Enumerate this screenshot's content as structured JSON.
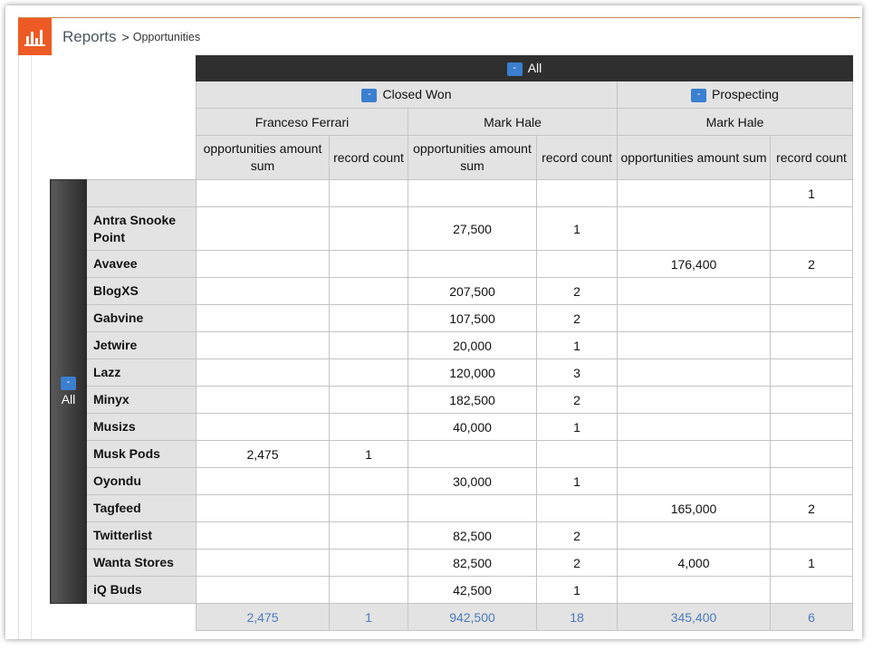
{
  "breadcrumb": {
    "root": "Reports",
    "separator": ">",
    "current": "Opportunities"
  },
  "icons": {
    "brand": "bar-chart-icon",
    "toggle": "collapse-toggle"
  },
  "colors": {
    "brand": "#ee5a24",
    "totals_text": "#4a7bbf",
    "toggle": "#3a7fd0"
  },
  "pivot": {
    "top_header": "All",
    "toggle_symbol": "-",
    "stages": [
      {
        "label": "Closed Won",
        "owners": [
          "Franceso Ferrari",
          "Mark Hale"
        ]
      },
      {
        "label": "Prospecting",
        "owners": [
          "Mark Hale"
        ]
      }
    ],
    "measures": [
      "opportunities amount sum",
      "record count"
    ],
    "row_header": "All",
    "rows": [
      {
        "label": "",
        "values": [
          "",
          "",
          "",
          "",
          "",
          "1"
        ]
      },
      {
        "label": "Antra Snooke Point",
        "values": [
          "",
          "",
          "27,500",
          "1",
          "",
          ""
        ]
      },
      {
        "label": "Avavee",
        "values": [
          "",
          "",
          "",
          "",
          "176,400",
          "2"
        ]
      },
      {
        "label": "BlogXS",
        "values": [
          "",
          "",
          "207,500",
          "2",
          "",
          ""
        ]
      },
      {
        "label": "Gabvine",
        "values": [
          "",
          "",
          "107,500",
          "2",
          "",
          ""
        ]
      },
      {
        "label": "Jetwire",
        "values": [
          "",
          "",
          "20,000",
          "1",
          "",
          ""
        ]
      },
      {
        "label": "Lazz",
        "values": [
          "",
          "",
          "120,000",
          "3",
          "",
          ""
        ]
      },
      {
        "label": "Minyx",
        "values": [
          "",
          "",
          "182,500",
          "2",
          "",
          ""
        ]
      },
      {
        "label": "Musizs",
        "values": [
          "",
          "",
          "40,000",
          "1",
          "",
          ""
        ]
      },
      {
        "label": "Musk Pods",
        "values": [
          "2,475",
          "1",
          "",
          "",
          "",
          ""
        ]
      },
      {
        "label": "Oyondu",
        "values": [
          "",
          "",
          "30,000",
          "1",
          "",
          ""
        ]
      },
      {
        "label": "Tagfeed",
        "values": [
          "",
          "",
          "",
          "",
          "165,000",
          "2"
        ]
      },
      {
        "label": "Twitterlist",
        "values": [
          "",
          "",
          "82,500",
          "2",
          "",
          ""
        ]
      },
      {
        "label": "Wanta Stores",
        "values": [
          "",
          "",
          "82,500",
          "2",
          "4,000",
          "1"
        ]
      },
      {
        "label": "iQ Buds",
        "values": [
          "",
          "",
          "42,500",
          "1",
          "",
          ""
        ]
      }
    ],
    "totals": [
      "2,475",
      "1",
      "942,500",
      "18",
      "345,400",
      "6"
    ]
  }
}
